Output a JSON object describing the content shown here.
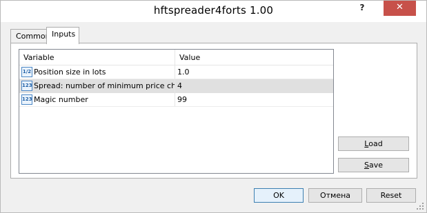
{
  "window": {
    "title": "hftspreader4forts 1.00",
    "help_glyph": "?",
    "close_glyph": "✕"
  },
  "tabs": [
    {
      "label": "Common",
      "active": false
    },
    {
      "label": "Inputs",
      "active": true
    }
  ],
  "grid": {
    "columns": [
      "Variable",
      "Value"
    ],
    "rows": [
      {
        "icon": "fraction-type-icon",
        "icon_glyph": "1/2",
        "variable": "Position size in lots",
        "value": "1.0",
        "selected": false
      },
      {
        "icon": "integer-type-icon",
        "icon_glyph": "123",
        "variable": "Spread: number of minimum price chan…",
        "value": "4",
        "selected": true
      },
      {
        "icon": "integer-type-icon",
        "icon_glyph": "123",
        "variable": "Magic number",
        "value": "99",
        "selected": false
      }
    ]
  },
  "side_buttons": {
    "load_mnemonic": "L",
    "load_rest": "oad",
    "save_mnemonic": "S",
    "save_rest": "ave"
  },
  "footer_buttons": {
    "ok": "OK",
    "cancel": "Отмена",
    "reset": "Reset"
  }
}
